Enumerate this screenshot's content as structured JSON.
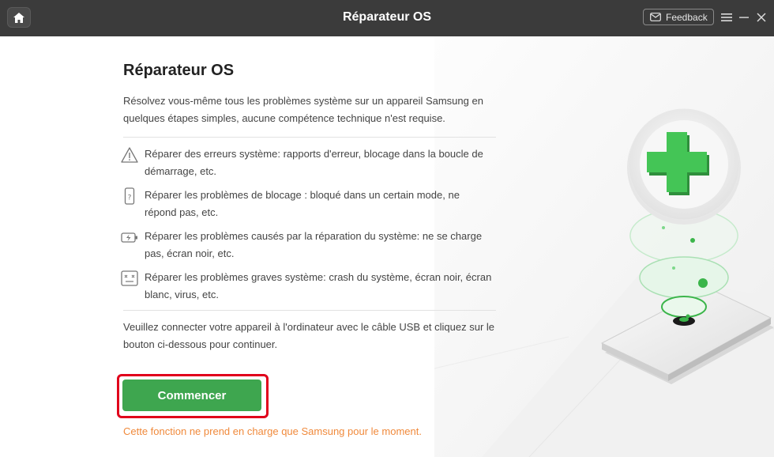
{
  "window": {
    "title": "Réparateur OS",
    "feedback_label": "Feedback"
  },
  "main": {
    "heading": "Réparateur OS",
    "intro": "Résolvez vous-même tous les problèmes système sur un appareil Samsung en quelques étapes simples, aucune compétence technique n'est requise.",
    "features": [
      {
        "icon": "warning-icon",
        "text": "Réparer des erreurs système: rapports d'erreur, blocage dans la boucle de démarrage, etc."
      },
      {
        "icon": "phone-question-icon",
        "text": "Réparer les problèmes de blocage : bloqué dans un certain mode, ne répond pas, etc."
      },
      {
        "icon": "battery-charge-icon",
        "text": "Réparer les problèmes causés par la réparation du système: ne se charge pas, écran noir, etc."
      },
      {
        "icon": "crash-screen-icon",
        "text": "Réparer les problèmes graves système: crash du système, écran noir, écran blanc, virus, etc."
      }
    ],
    "instruction": "Veuillez connecter votre appareil à l'ordinateur avec le câble USB et cliquez sur le bouton ci-dessous pour continuer.",
    "start_label": "Commencer",
    "note": "Cette fonction ne prend en charge que Samsung pour le moment."
  },
  "colors": {
    "accent": "#3ea64f",
    "highlight": "#e0001b",
    "note": "#f08a3c",
    "titlebar": "#3b3b3b"
  }
}
